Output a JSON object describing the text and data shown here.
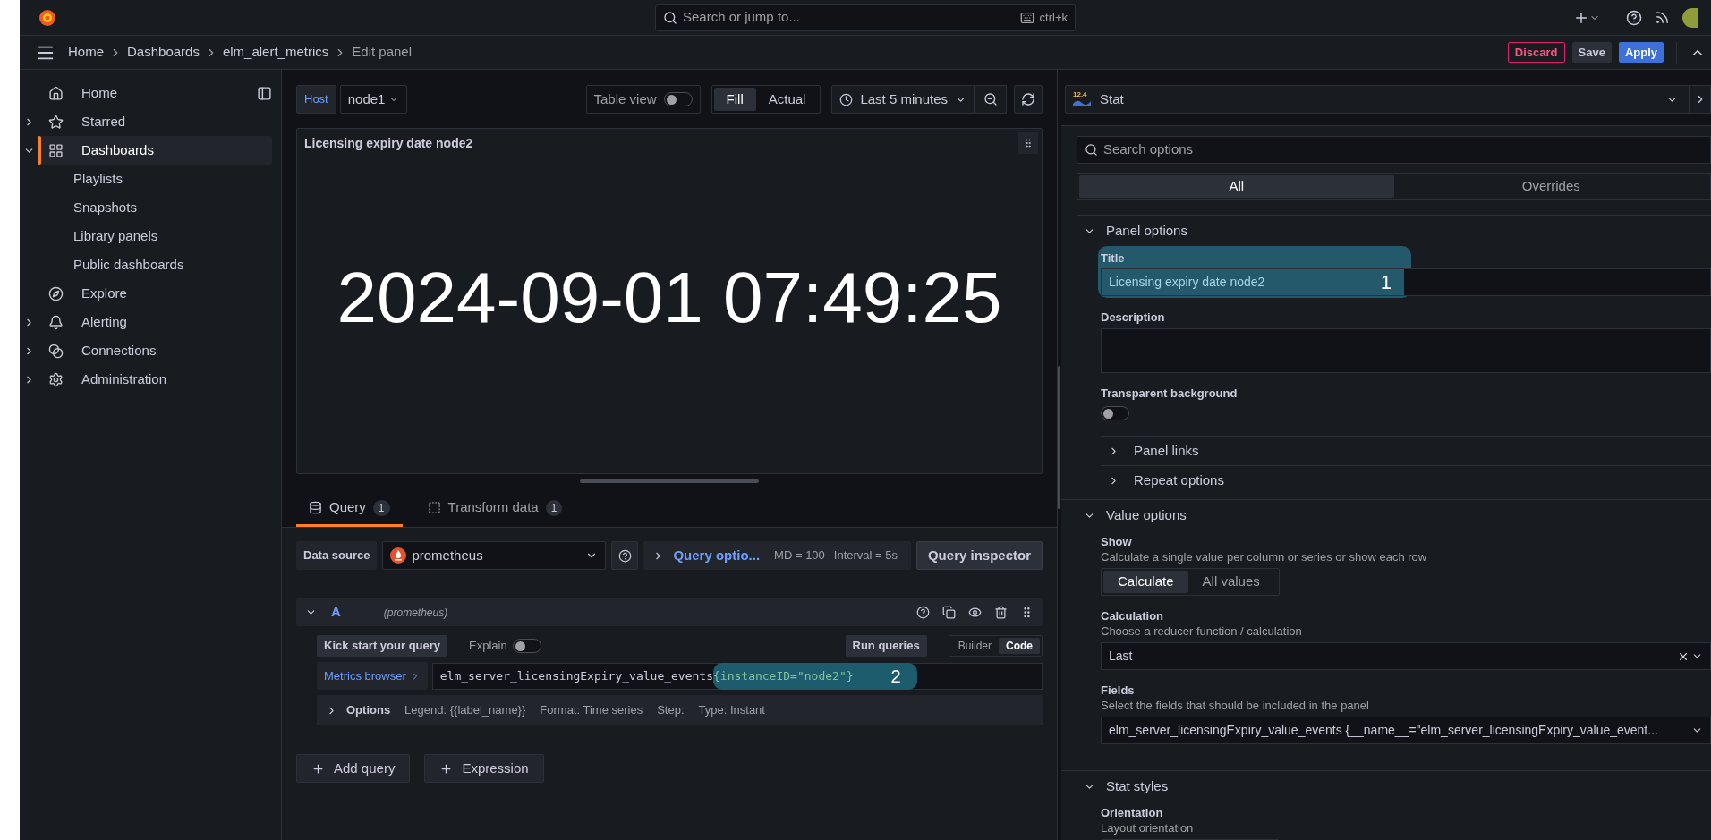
{
  "topbar": {
    "search": {
      "placeholder": "Search or jump to...",
      "shortcut": "ctrl+k"
    }
  },
  "breadcrumbs": [
    {
      "label": "Home",
      "current": false
    },
    {
      "label": "Dashboards",
      "current": false
    },
    {
      "label": "elm_alert_metrics",
      "current": false
    },
    {
      "label": "Edit panel",
      "current": true
    }
  ],
  "actions": [
    {
      "label": "Discard",
      "kind": "danger"
    },
    {
      "label": "Save",
      "kind": "secondary"
    },
    {
      "label": "Apply",
      "kind": "primary"
    }
  ],
  "sidebar": {
    "items": [
      {
        "label": "Home",
        "selected": false
      },
      {
        "label": "Starred",
        "expanded": false,
        "selected": false
      },
      {
        "label": "Dashboards",
        "expanded": true,
        "selected": true,
        "children": [
          {
            "label": "Playlists"
          },
          {
            "label": "Snapshots"
          },
          {
            "label": "Library panels"
          },
          {
            "label": "Public dashboards"
          }
        ]
      },
      {
        "label": "Explore",
        "selected": false
      },
      {
        "label": "Alerting",
        "expanded": false,
        "selected": false
      },
      {
        "label": "Connections",
        "expanded": false,
        "selected": false
      },
      {
        "label": "Administration",
        "expanded": false,
        "selected": false
      }
    ]
  },
  "variables": [
    {
      "label": "Host",
      "value": "node1"
    }
  ],
  "toolbar": {
    "table_view": {
      "label": "Table view",
      "on": false
    },
    "fill_modes": [
      {
        "label": "Fill",
        "selected": true
      },
      {
        "label": "Actual",
        "selected": false
      }
    ],
    "time_range": "Last 5 minutes"
  },
  "panel": {
    "title": "Licensing expiry date node2",
    "value": "2024-09-01 07:49:25"
  },
  "editor_tabs": [
    {
      "label": "Query",
      "count": "1",
      "selected": true
    },
    {
      "label": "Transform data",
      "count": "1",
      "selected": false
    }
  ],
  "query_toolbar": {
    "data_source_label": "Data source",
    "data_source": "prometheus",
    "query_options": "Query optio...",
    "max_data_points": "MD = 100",
    "interval": "Interval = 5s",
    "inspector": "Query inspector"
  },
  "queries": [
    {
      "ref": "A",
      "datasource": "(prometheus)",
      "expanded": true,
      "kick_start": "Kick start your query",
      "explain": {
        "label": "Explain",
        "on": false
      },
      "run": "Run queries",
      "modes": [
        {
          "label": "Builder",
          "selected": false
        },
        {
          "label": "Code",
          "selected": true
        }
      ],
      "metrics_browser": "Metrics browser",
      "expr_metric": "elm_server_licensingExpiry_value_events",
      "expr_labels": "{instanceID=\"node2\"}",
      "annotation": "2",
      "options": {
        "label": "Options",
        "legend": "Legend: {{label_name}}",
        "format": "Format: Time series",
        "step": "Step:",
        "type": "Type: Instant"
      }
    }
  ],
  "query_actions": [
    {
      "label": "Add query"
    },
    {
      "label": "Expression"
    }
  ],
  "options_pane": {
    "visualization": {
      "name": "Stat",
      "icon_label": "12.4"
    },
    "search": {
      "placeholder": "Search options"
    },
    "tabs": [
      {
        "label": "All",
        "selected": true
      },
      {
        "label": "Overrides",
        "selected": false
      }
    ],
    "sections": [
      {
        "title": "Panel options",
        "expanded": true,
        "items": [
          {
            "kind": "text",
            "label": "Title",
            "value": "Licensing expiry date node2",
            "annotation": "1"
          },
          {
            "kind": "textarea",
            "label": "Description"
          },
          {
            "kind": "switch",
            "label": "Transparent background",
            "on": false
          },
          {
            "kind": "group",
            "label": "Panel links",
            "expanded": false
          },
          {
            "kind": "group",
            "label": "Repeat options",
            "expanded": false
          }
        ]
      },
      {
        "title": "Value options",
        "expanded": true,
        "items": [
          {
            "kind": "radio",
            "label": "Show",
            "description": "Calculate a single value per column or series or show each row",
            "options": [
              {
                "label": "Calculate",
                "selected": true
              },
              {
                "label": "All values",
                "selected": false
              }
            ]
          },
          {
            "kind": "select",
            "label": "Calculation",
            "description": "Choose a reducer function / calculation",
            "value": "Last",
            "clearable": true
          },
          {
            "kind": "select",
            "label": "Fields",
            "description": "Select the fields that should be included in the panel",
            "value": "elm_server_licensingExpiry_value_events {__name__=\"elm_server_licensingExpiry_value_event...",
            "clearable": false
          }
        ]
      },
      {
        "title": "Stat styles",
        "expanded": true,
        "items": [
          {
            "kind": "radio",
            "label": "Orientation",
            "description": "Layout orientation"
          }
        ]
      }
    ]
  }
}
